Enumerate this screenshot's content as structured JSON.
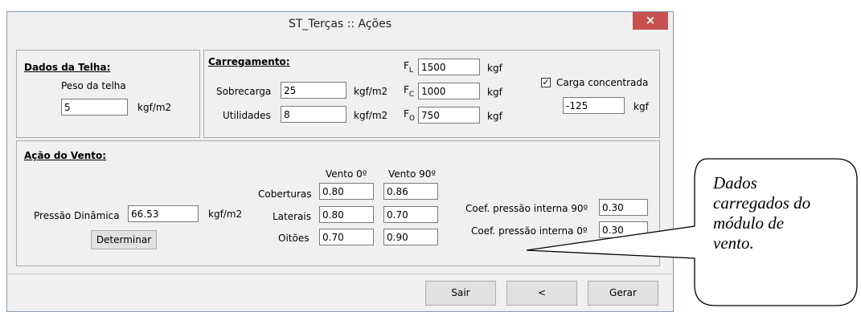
{
  "window": {
    "title": "ST_Terças :: Ações",
    "close_glyph": "×"
  },
  "telha": {
    "heading": "Dados da Telha:",
    "peso_label": "Peso da telha",
    "peso_value": "5",
    "peso_unit": "kgf/m2"
  },
  "carregamento": {
    "heading": "Carregamento:",
    "sobrecarga_label": "Sobrecarga",
    "sobrecarga_value": "25",
    "sobrecarga_unit": "kgf/m2",
    "utilidades_label": "Utilidades",
    "utilidades_value": "8",
    "utilidades_unit": "kgf/m2",
    "fl_letter": "F",
    "fl_sub": "L",
    "fl_value": "1500",
    "fl_unit": "kgf",
    "fc_letter": "F",
    "fc_sub": "C",
    "fc_value": "1000",
    "fc_unit": "kgf",
    "fo_letter": "F",
    "fo_sub": "O",
    "fo_value": "750",
    "fo_unit": "kgf",
    "carga_label": "Carga concentrada",
    "carga_checked_glyph": "✓",
    "carga_value": "-125",
    "carga_unit": "kgf"
  },
  "vento": {
    "heading": "Ação do Vento:",
    "pressao_label": "Pressão Dinâmica",
    "pressao_value": "66.53",
    "pressao_unit": "kgf/m2",
    "determinar_label": "Determinar",
    "col0_header": "Vento 0º",
    "col90_header": "Vento 90º",
    "coberturas_label": "Coberturas",
    "coberturas_0": "0.80",
    "coberturas_90": "0.86",
    "laterais_label": "Laterais",
    "laterais_0": "0.80",
    "laterais_90": "0.70",
    "oitoes_label": "Oitões",
    "oitoes_0": "0.70",
    "oitoes_90": "0.90",
    "coef90_label": "Coef. pressão interna 90º",
    "coef90_value": "0.30",
    "coef0_label": "Coef. pressão interna 0º",
    "coef0_value": "0.30"
  },
  "buttons": {
    "sair": "Sair",
    "back": "<",
    "gerar": "Gerar"
  },
  "callout": {
    "line1": "Dados",
    "line2": "carregados do",
    "line3": "módulo de",
    "line4": "vento."
  }
}
